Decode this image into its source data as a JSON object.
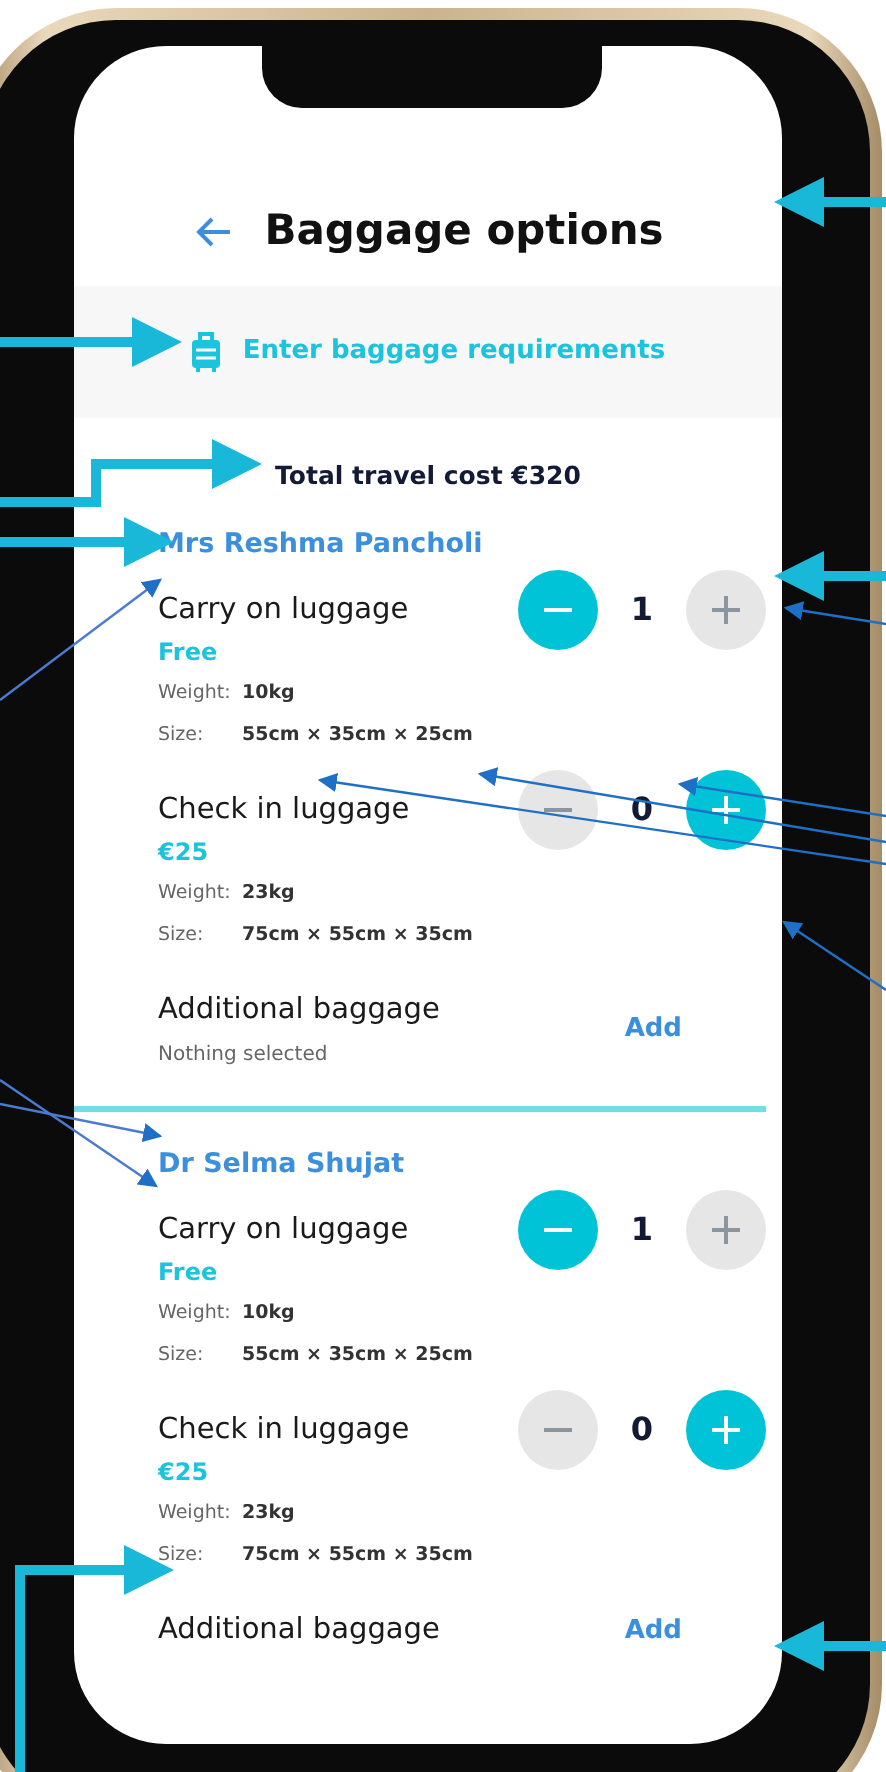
{
  "header": {
    "title": "Baggage options"
  },
  "banner": {
    "label": "Enter baggage requirements"
  },
  "total": "Total travel cost €320",
  "passengers": [
    {
      "name": "Mrs Reshma Pancholi",
      "items": [
        {
          "kind": "stepper",
          "title": "Carry on luggage",
          "price": "Free",
          "weight_label": "Weight:",
          "weight": "10kg",
          "size_label": "Size:",
          "size": "55cm × 35cm × 25cm",
          "count": "1",
          "minus_enabled": true,
          "plus_enabled": false
        },
        {
          "kind": "stepper",
          "title": "Check in luggage",
          "price": "€25",
          "weight_label": "Weight:",
          "weight": "23kg",
          "size_label": "Size:",
          "size": "75cm × 55cm × 35cm",
          "count": "0",
          "minus_enabled": false,
          "plus_enabled": true
        },
        {
          "kind": "additional",
          "title": "Additional baggage",
          "note": "Nothing selected",
          "action": "Add"
        }
      ]
    },
    {
      "name": "Dr Selma Shujat",
      "items": [
        {
          "kind": "stepper",
          "title": "Carry on luggage",
          "price": "Free",
          "weight_label": "Weight:",
          "weight": "10kg",
          "size_label": "Size:",
          "size": "55cm × 35cm × 25cm",
          "count": "1",
          "minus_enabled": true,
          "plus_enabled": false
        },
        {
          "kind": "stepper",
          "title": "Check in luggage",
          "price": "€25",
          "weight_label": "Weight:",
          "weight": "23kg",
          "size_label": "Size:",
          "size": "75cm × 55cm × 35cm",
          "count": "0",
          "minus_enabled": false,
          "plus_enabled": true
        },
        {
          "kind": "additional",
          "title": "Additional baggage",
          "action": "Add"
        }
      ]
    }
  ]
}
